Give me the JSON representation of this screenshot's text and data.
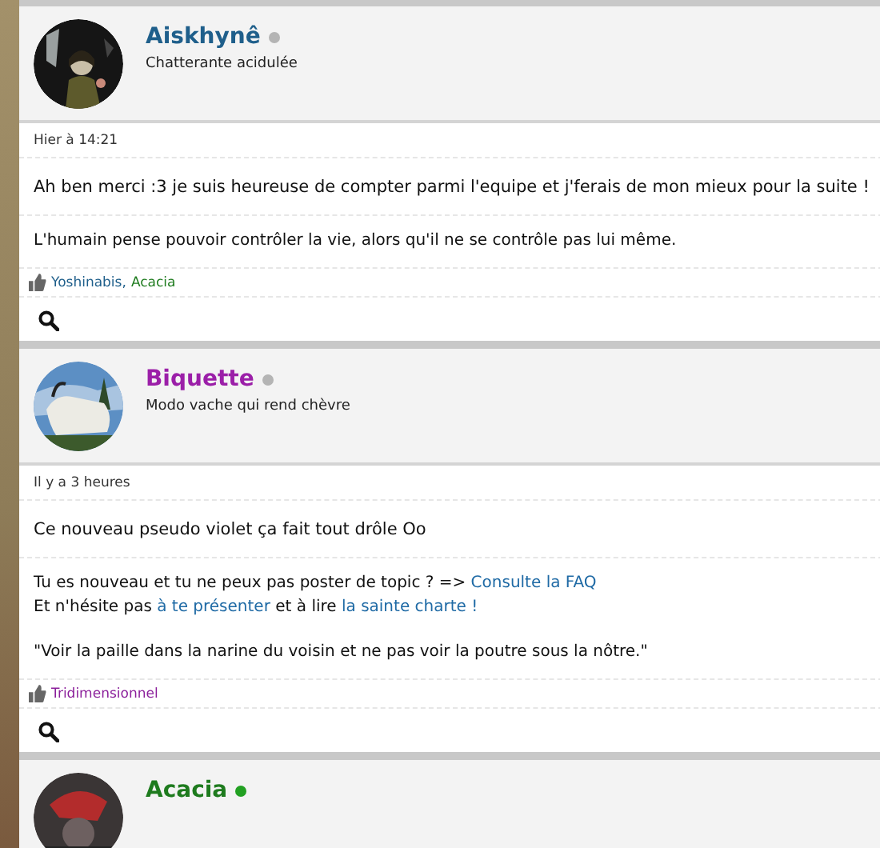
{
  "posts": [
    {
      "author": {
        "name": "Aiskhynê",
        "color": "#1f5f8b",
        "online": false,
        "rank": "Chatterante acidulée"
      },
      "date": "Hier à 14:21",
      "message": "Ah ben merci :3 je suis heureuse de compter parmi l'equipe et j'ferais de mon mieux pour la suite !",
      "signature": [
        [
          [
            {
              "kind": "text",
              "text": "L'humain pense pouvoir contrôler la vie, alors qu'il ne se contrôle pas lui même."
            }
          ]
        ]
      ],
      "likes": [
        {
          "name": "Yoshinabis,",
          "color": "#1f5f8b"
        },
        {
          "name": "Acacia",
          "color": "#1e7b1e"
        }
      ]
    },
    {
      "author": {
        "name": "Biquette",
        "color": "#9b1fa8",
        "online": false,
        "rank": "Modo vache qui rend chèvre"
      },
      "date": "Il y a 3 heures",
      "message": "Ce nouveau pseudo violet ça fait tout drôle Oo",
      "signature": [
        [
          [
            {
              "kind": "text",
              "text": "Tu es nouveau et tu ne peux pas poster de topic ? => "
            },
            {
              "kind": "link",
              "text": "Consulte la FAQ"
            }
          ],
          [
            {
              "kind": "text",
              "text": "Et n'hésite pas "
            },
            {
              "kind": "link",
              "text": "à te présenter"
            },
            {
              "kind": "text",
              "text": " et à lire "
            },
            {
              "kind": "link",
              "text": "la sainte charte !"
            }
          ]
        ],
        [
          [
            {
              "kind": "text",
              "text": "\"Voir la paille dans la narine du voisin et ne pas voir la poutre sous la nôtre.\""
            }
          ]
        ]
      ],
      "likes": [
        {
          "name": "Tridimensionnel",
          "color": "#8b1f9b"
        }
      ]
    },
    {
      "author": {
        "name": "Acacia",
        "color": "#1e7b1e",
        "online": true
      }
    }
  ]
}
